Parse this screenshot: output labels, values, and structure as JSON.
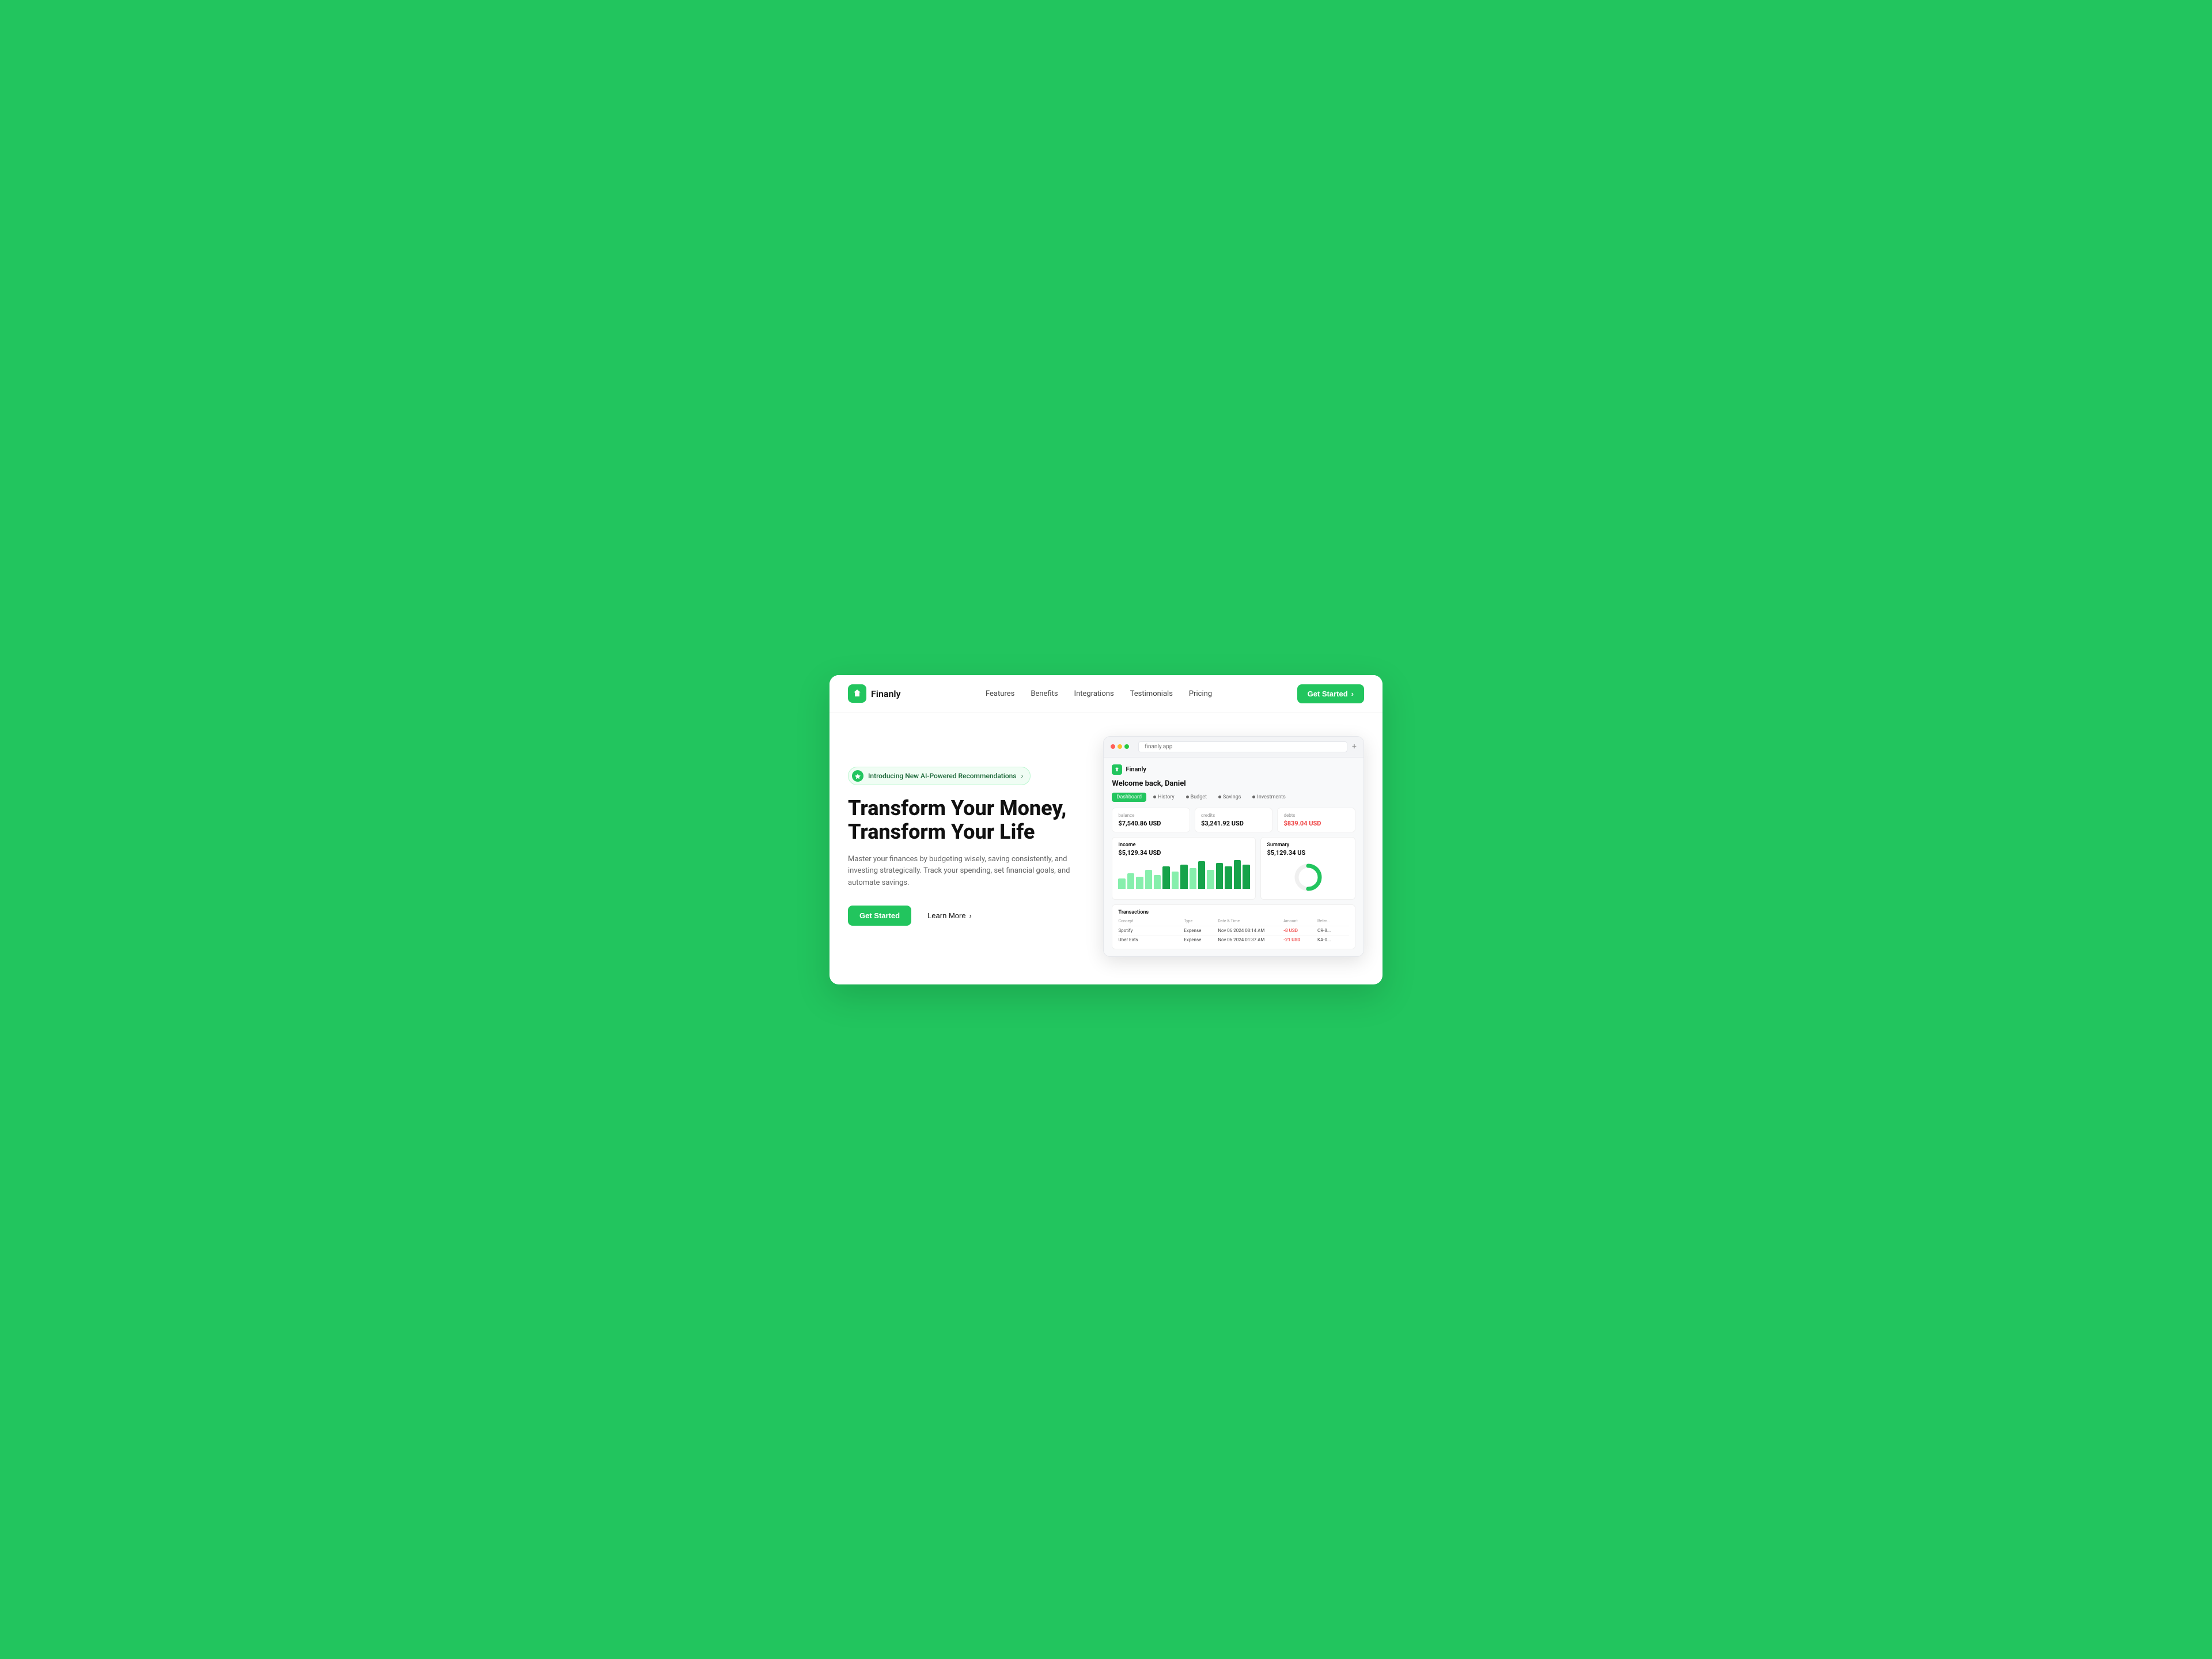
{
  "background": {
    "color": "#22c55e"
  },
  "navbar": {
    "logo_text": "Finanly",
    "logo_icon": "💰",
    "links": [
      {
        "label": "Features",
        "id": "features"
      },
      {
        "label": "Benefits",
        "id": "benefits"
      },
      {
        "label": "Integrations",
        "id": "integrations"
      },
      {
        "label": "Testimonials",
        "id": "testimonials"
      },
      {
        "label": "Pricing",
        "id": "pricing"
      }
    ],
    "cta_label": "Get Started",
    "cta_arrow": "›"
  },
  "hero": {
    "badge_text": "Introducing New AI-Powered Recommendations",
    "badge_arrow": "›",
    "title_line1": "Transform Your Money,",
    "title_line2": "Transform Your Life",
    "subtitle": "Master your finances by budgeting wisely, saving consistently, and investing strategically. Track your spending, set financial goals, and automate savings.",
    "cta_primary": "Get Started",
    "cta_secondary": "Learn More",
    "cta_secondary_arrow": "›"
  },
  "app_preview": {
    "browser_url": "finanly.app",
    "app_name": "Finanly",
    "welcome": "Welcome back, Daniel",
    "tabs": [
      {
        "label": "Dashboard",
        "active": true
      },
      {
        "label": "History"
      },
      {
        "label": "Budget"
      },
      {
        "label": "Savings"
      },
      {
        "label": "Investments"
      }
    ],
    "stats": [
      {
        "label": "balance",
        "value": "$7,540.86 USD"
      },
      {
        "label": "credits",
        "value": "$3,241.92 USD"
      },
      {
        "label": "debts",
        "value": "$839.04 USD",
        "color": "red"
      }
    ],
    "income_chart": {
      "title": "Income",
      "value": "$5,129.34 USD",
      "bars": [
        30,
        45,
        35,
        55,
        40,
        65,
        50,
        70,
        60,
        80,
        55,
        75,
        65,
        85,
        70
      ]
    },
    "summary_chart": {
      "title": "Summary",
      "value": "$5,129.34 US",
      "donut_pct": 75
    },
    "transactions": {
      "title": "Transactions",
      "headers": [
        "Concept",
        "Type",
        "Date & Time",
        "Amount",
        "Refer..."
      ],
      "rows": [
        {
          "concept": "Spotify",
          "type": "Expense",
          "datetime": "Nov 06 2024 08:14 AM",
          "amount": "-8 USD",
          "ref": "CR-8..."
        },
        {
          "concept": "Uber Eats",
          "type": "Expense",
          "datetime": "Nov 06 2024 01:37 AM",
          "amount": "-21 USD",
          "ref": "KA-0..."
        }
      ]
    }
  },
  "colors": {
    "green": "#22c55e",
    "dark_green": "#166534",
    "light_green_bg": "#f0fdf4",
    "text_dark": "#111111",
    "text_gray": "#666666",
    "text_light": "#999999",
    "red": "#ef4444",
    "white": "#ffffff"
  }
}
